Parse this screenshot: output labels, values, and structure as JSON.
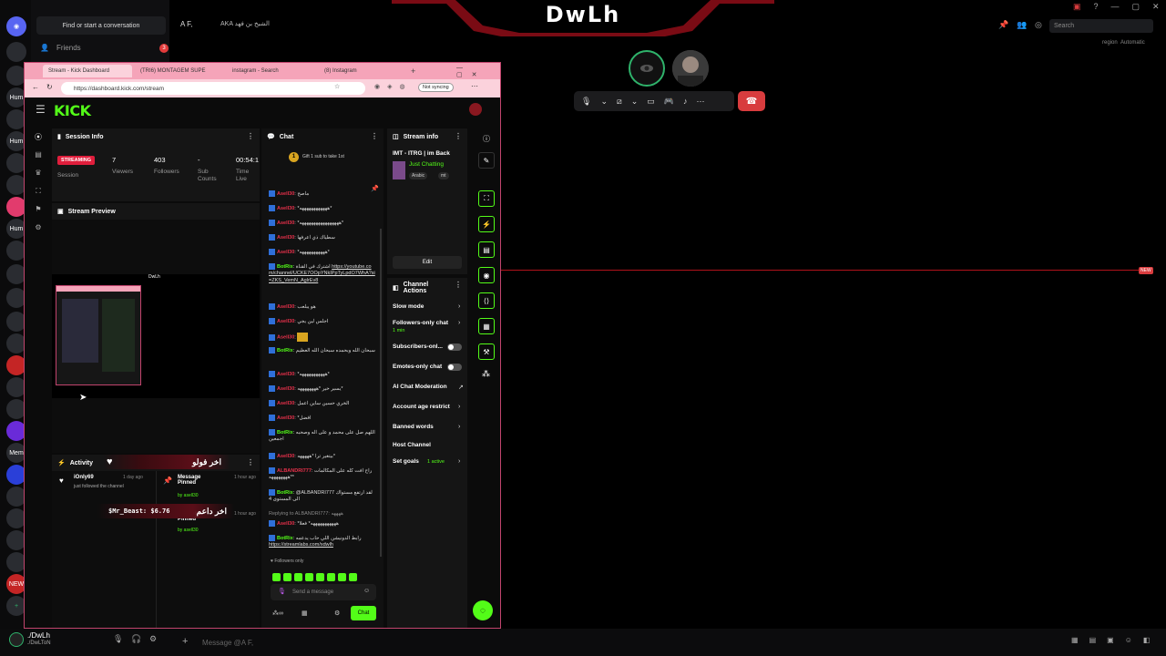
{
  "banner": {
    "title": "DwLh"
  },
  "discord": {
    "find_placeholder": "Find or start a conversation",
    "friends_label": "Friends",
    "friends_badge": "3",
    "dm_name": "A F,",
    "dm_aka": "AKA",
    "dm_alias": "الشيخ بن فهد",
    "search_placeholder": "Search",
    "region_label": "region",
    "region_value": "Automatic",
    "message_placeholder": "Message @A F,",
    "user_name": "./DwLh",
    "user_tag": "./DwLToN",
    "new_tag": "NEW",
    "guild_labels": [
      "Hum",
      "Hum",
      "Hum",
      "NEW",
      "Hum",
      "Mem"
    ]
  },
  "browser": {
    "tabs": [
      {
        "label": "Stream - Kick Dashboard",
        "active": true
      },
      {
        "label": "(TRI6) MONTAGEM SUPE",
        "active": false
      },
      {
        "label": "instagram - Search",
        "active": false
      },
      {
        "label": "(8) Instagram",
        "active": false
      }
    ],
    "url": "https://dashboard.kick.com/stream",
    "sync_label": "Not syncing"
  },
  "kick": {
    "logo": "KICK",
    "session": {
      "title": "Session Info",
      "badge": "STREAMING",
      "session_label": "Session",
      "viewers_value": "7",
      "viewers_label": "Viewers",
      "followers_value": "403",
      "followers_label": "Followers",
      "subs_value": "-",
      "subs_label": "Sub Counts",
      "time_value": "00:54:1",
      "time_label": "Time Live"
    },
    "preview": {
      "title": "Stream Preview",
      "mini_title": "DwLh"
    },
    "activity": {
      "title": "Activity",
      "items": [
        {
          "user": "iOnly69",
          "time": "1 day ago",
          "text": "just followed the channel"
        },
        {
          "user": "Message Pinned",
          "time": "1 hour ago",
          "text": "by asell30"
        },
        {
          "user": "Message Pinned",
          "time": "1 hour ago",
          "text": "by asell30"
        }
      ]
    },
    "overlays": {
      "top": "اخر فولو",
      "bottom_amount": "$Mr_Beast: $6.76",
      "bottom": "اخر داعم"
    },
    "chat": {
      "title": "Chat",
      "gift": "Gift 1 sub to take 1st",
      "gift_rank": "1",
      "messages": [
        {
          "user": "Asell30",
          "text": "ماصح",
          "bot": false
        },
        {
          "user": "Asell30",
          "text": "*ههههههههههههه*",
          "bot": false
        },
        {
          "user": "Asell30",
          "text": "*هههههههههههههههههه*",
          "bot": false
        },
        {
          "user": "Asell30",
          "text": "سطياك ذي اعرفها",
          "bot": false
        },
        {
          "user": "Asell30",
          "text": "*هههههههههههه*",
          "bot": false
        },
        {
          "user": "BotRix",
          "text": "اشترك في القناة",
          "bot": true,
          "link": "https://youtube.com/channel/UCKE7OOpYNkIPpTyLpdO7WhA?si=ZKS_VemN_AglrEv8"
        },
        {
          "user": "Asell30",
          "text": "هو يبلعب",
          "bot": false
        },
        {
          "user": "Asell30",
          "text": "اجلس لين يجي",
          "bot": false
        },
        {
          "user": "Asell30",
          "text": "",
          "bot": false
        },
        {
          "user": "BotRix",
          "text": "سبحان الله وبحمده سبحان الله العظيم",
          "bot": true
        },
        {
          "user": "Asell30",
          "text": "*هههههههههههه*",
          "bot": false
        },
        {
          "user": "Asell30",
          "text": "يسير خير *ههههههههه*",
          "bot": false
        },
        {
          "user": "Asell30",
          "text": "الخري حسين ساين اعمل",
          "bot": false
        },
        {
          "user": "Asell30",
          "text": "*افضل",
          "bot": false
        },
        {
          "user": "BotRix",
          "text": "اللهم صل على محمد و على اله وصحبه اجمعين",
          "bot": true
        },
        {
          "user": "Asell30",
          "text": "بيتغير ترا *هههههه*",
          "bot": false
        },
        {
          "user": "ALBANDRI777",
          "text": "راح افت كله على المكالمات *ههههههههه*",
          "bot": false
        },
        {
          "user": "BotRix",
          "text": "@ALBANDRI777 لقد ارتفع مستواك الى المستوى 4",
          "bot": true
        },
        {
          "user": "Asell30",
          "text": "*هههههههههههه* فعلا",
          "bot": false
        },
        {
          "user": "BotRix",
          "text": "رابط الدونيشن اللي حاب يدعمه",
          "bot": true,
          "link": "https://streamlabs.com/xdwlh"
        }
      ],
      "reply_hint": "Replying to ALBANDRI777: ههههه",
      "followers_only": "Followers only",
      "input_placeholder": "Send a message",
      "send_label": "Chat"
    },
    "stream_info": {
      "title": "Stream info",
      "stream_title": "IMT - ITRG | im Back",
      "category": "Just Chatting",
      "tags": [
        "Arabic",
        "mt"
      ],
      "edit_label": "Edit"
    },
    "channel_actions": {
      "title": "Channel Actions",
      "slow_mode": "Slow mode",
      "followers_chat": "Followers-only chat",
      "followers_chat_sub": "1 min",
      "subs_only": "Subscribers-onl...",
      "emotes_only": "Emotes-only chat",
      "ai_mod": "AI Chat Moderation",
      "age_restrict": "Account age restrict",
      "banned_words": "Banned words",
      "host": "Host Channel",
      "goals": "Set goals",
      "goals_sub": "1 active"
    }
  },
  "colors": {
    "kick_green": "#53fc18",
    "accent_red": "#e01e3c",
    "browser_pink": "#f5a4b9"
  }
}
